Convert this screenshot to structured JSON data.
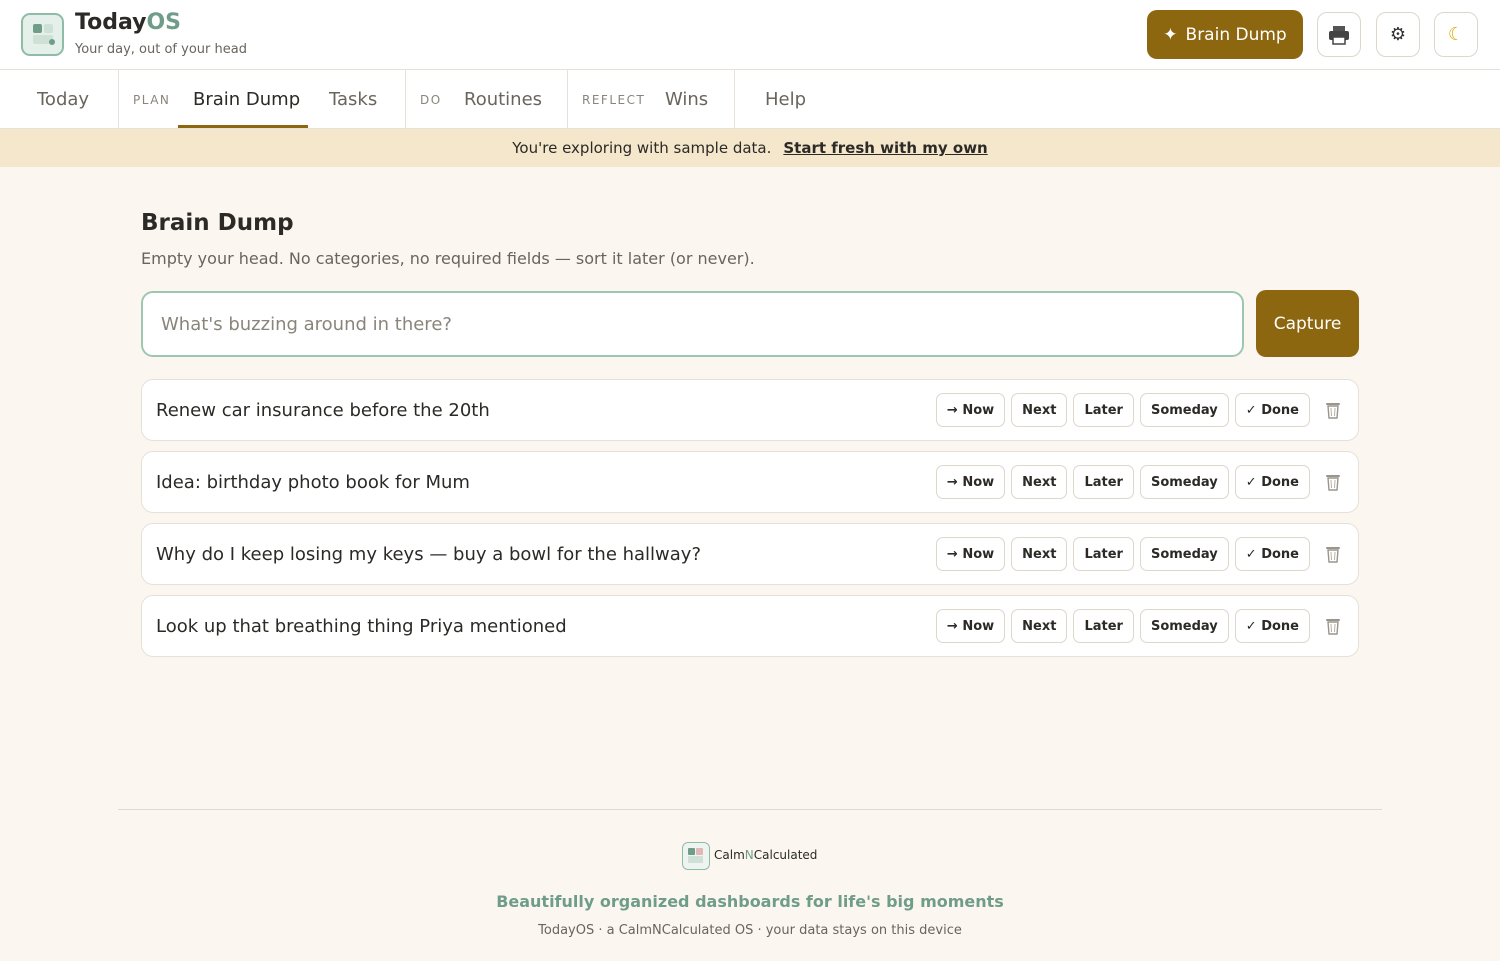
{
  "app": {
    "name_main": "Today",
    "name_accent": "OS",
    "tagline": "Your day, out of your head"
  },
  "header": {
    "brain_dump_label": "Brain Dump",
    "brain_dump_icon": "sparkle-icon",
    "print_icon": "printer-icon",
    "settings_icon": "gear-icon",
    "theme_icon": "moon-icon"
  },
  "nav": {
    "today": "Today",
    "group_plan": "PLAN",
    "brain_dump": "Brain Dump",
    "tasks": "Tasks",
    "group_do": "DO",
    "routines": "Routines",
    "group_reflect": "REFLECT",
    "wins": "Wins",
    "help": "Help"
  },
  "banner": {
    "text": "You're exploring with sample data.",
    "link": "Start fresh with my own"
  },
  "main": {
    "title": "Brain Dump",
    "subtitle": "Empty your head. No categories, no required fields — sort it later (or never).",
    "input_placeholder": "What's buzzing around in there?",
    "capture_label": "Capture"
  },
  "actions": {
    "now": "→ Now",
    "next": "Next",
    "later": "Later",
    "someday": "Someday",
    "done": "✓ Done"
  },
  "items": [
    {
      "text": "Renew car insurance before the 20th"
    },
    {
      "text": "Idea: birthday photo book for Mum"
    },
    {
      "text": "Why do I keep losing my keys — buy a bowl for the hallway?"
    },
    {
      "text": "Look up that breathing thing Priya mentioned"
    }
  ],
  "footer": {
    "brand_a": "Calm",
    "brand_n": "N",
    "brand_b": "Calculated",
    "tagline": "Beautifully organized dashboards for life's big moments",
    "meta": "TodayOS · a CalmNCalculated OS · your data stays on this device"
  },
  "colors": {
    "accent": "#8d6610",
    "brand_green": "#6f9d8a",
    "banner": "#f5e7cc",
    "background": "#fbf7f0"
  }
}
